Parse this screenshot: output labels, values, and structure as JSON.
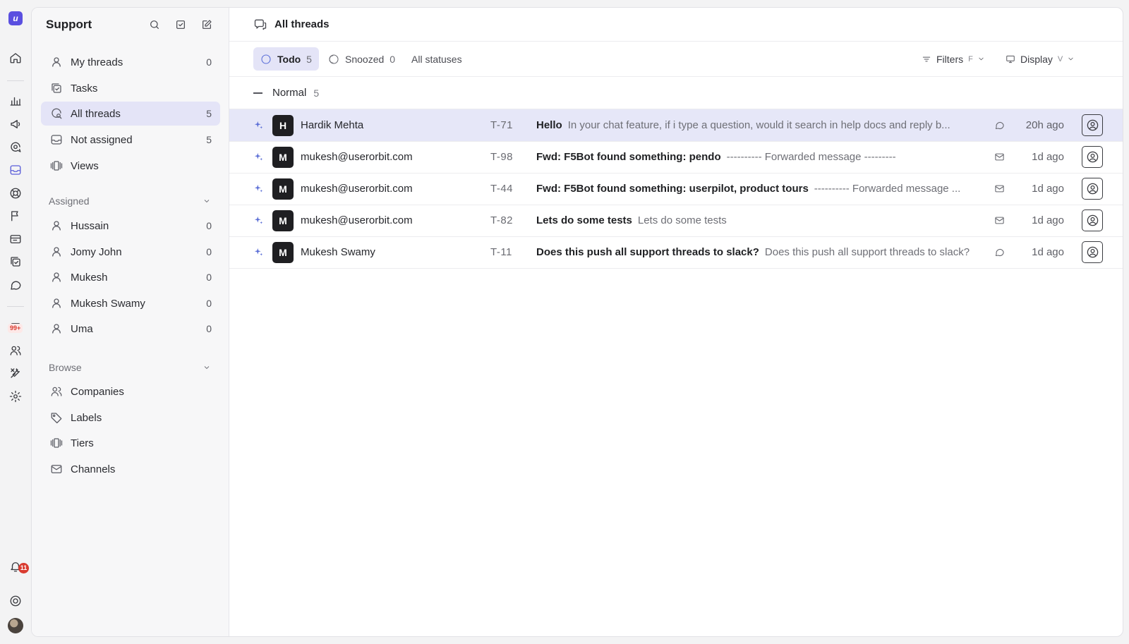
{
  "sidebar": {
    "title": "Support",
    "top_items": [
      {
        "label": "My threads",
        "count": "0"
      },
      {
        "label": "Tasks",
        "count": ""
      },
      {
        "label": "All threads",
        "count": "5"
      },
      {
        "label": "Not assigned",
        "count": "5"
      },
      {
        "label": "Views",
        "count": ""
      }
    ],
    "assigned_header": "Assigned",
    "assigned_items": [
      {
        "label": "Hussain",
        "count": "0"
      },
      {
        "label": "Jomy John",
        "count": "0"
      },
      {
        "label": "Mukesh",
        "count": "0"
      },
      {
        "label": "Mukesh Swamy",
        "count": "0"
      },
      {
        "label": "Uma",
        "count": "0"
      }
    ],
    "browse_header": "Browse",
    "browse_items": [
      {
        "label": "Companies"
      },
      {
        "label": "Labels"
      },
      {
        "label": "Tiers"
      },
      {
        "label": "Channels"
      }
    ]
  },
  "rail": {
    "logo": "u",
    "inbox_badge": "99+",
    "notifications_badge": "11"
  },
  "header": {
    "title": "All threads"
  },
  "filters": {
    "tabs": [
      {
        "label": "Todo",
        "count": "5"
      },
      {
        "label": "Snoozed",
        "count": "0"
      },
      {
        "label": "All statuses"
      }
    ],
    "filters_label": "Filters",
    "filters_key": "F",
    "display_label": "Display",
    "display_key": "V"
  },
  "group": {
    "label": "Normal",
    "count": "5"
  },
  "threads": [
    {
      "initial": "H",
      "name": "Hardik Mehta",
      "id": "T-71",
      "subject": "Hello",
      "preview": "In your chat feature, if i type a question, would it search in help docs and reply b...",
      "channel_icon": "chat-icon",
      "time": "20h ago"
    },
    {
      "initial": "M",
      "name": "mukesh@userorbit.com",
      "id": "T-98",
      "subject": "Fwd: F5Bot found something: pendo",
      "preview": "---------- Forwarded message ---------",
      "channel_icon": "mail-icon",
      "time": "1d ago"
    },
    {
      "initial": "M",
      "name": "mukesh@userorbit.com",
      "id": "T-44",
      "subject": "Fwd: F5Bot found something: userpilot, product tours",
      "preview": "---------- Forwarded message ...",
      "channel_icon": "mail-icon",
      "time": "1d ago"
    },
    {
      "initial": "M",
      "name": "mukesh@userorbit.com",
      "id": "T-82",
      "subject": "Lets do some tests",
      "preview": "Lets do some tests",
      "channel_icon": "mail-icon",
      "time": "1d ago"
    },
    {
      "initial": "M",
      "name": "Mukesh Swamy",
      "id": "T-11",
      "subject": "Does this push all support threads to slack?",
      "preview": "Does this push all support threads to slack?",
      "channel_icon": "chat-icon",
      "time": "1d ago"
    }
  ],
  "colors": {
    "accent": "#5b5fd9",
    "selected_bg": "#e6e7f8",
    "active_nav_bg": "#e4e4f7",
    "badge_red": "#d93b30"
  }
}
